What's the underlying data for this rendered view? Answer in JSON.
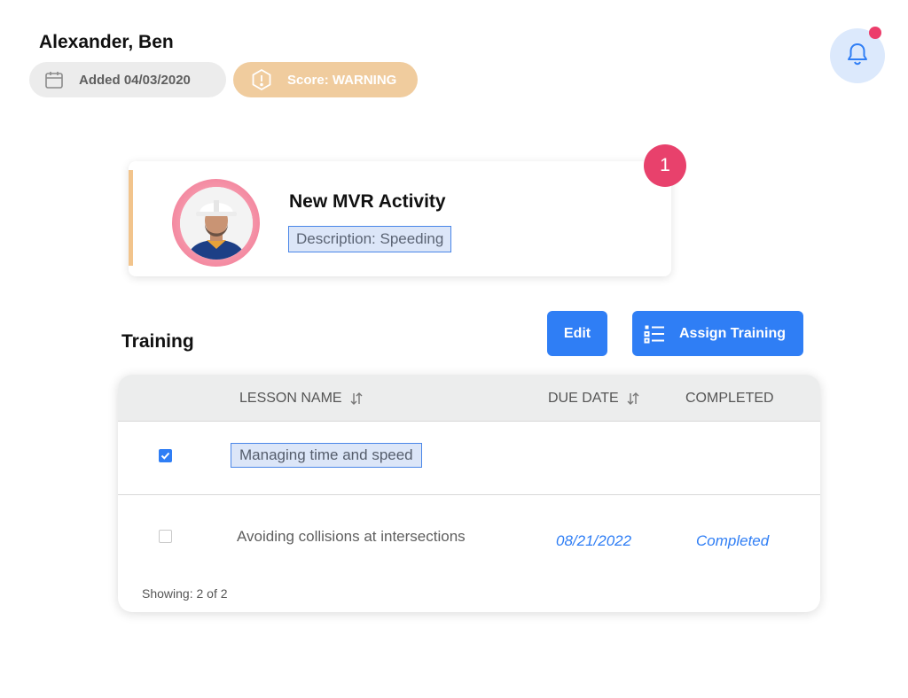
{
  "header": {
    "name": "Alexander, Ben",
    "added_label": "Added 04/03/2020",
    "score_label": "Score: WARNING"
  },
  "notifications": {
    "icon": "bell-icon",
    "has_unread": true
  },
  "activity": {
    "title": "New MVR Activity",
    "description": "Description: Speeding",
    "count": "1"
  },
  "training": {
    "title": "Training",
    "edit_label": "Edit",
    "assign_label": "Assign Training",
    "columns": {
      "lesson": "LESSON NAME",
      "due": "DUE DATE",
      "completed": "COMPLETED"
    },
    "rows": [
      {
        "lesson": "Managing time and speed",
        "due": "",
        "completed": "",
        "checked": true
      },
      {
        "lesson": "Avoiding collisions at intersections",
        "due": "08/21/2022",
        "completed": "Completed",
        "checked": false
      }
    ],
    "showing": "Showing: 2 of 2"
  },
  "colors": {
    "primary": "#2f7ef5",
    "warning": "#f0cc9e",
    "badge": "#e8416c",
    "accent": "#f2c48c"
  }
}
